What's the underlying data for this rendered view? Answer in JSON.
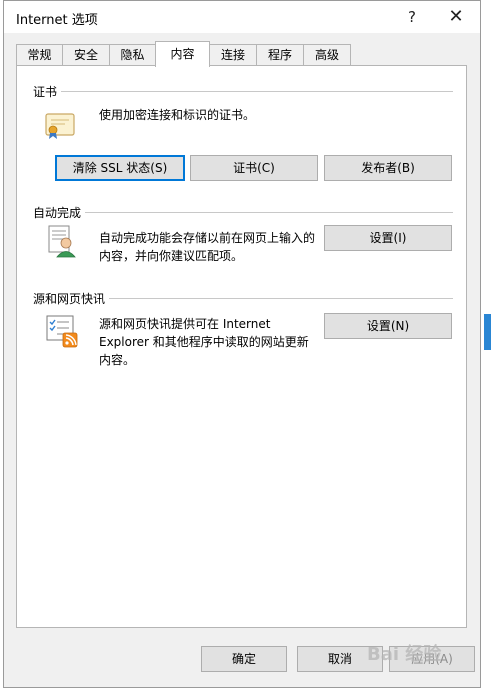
{
  "window": {
    "title": "Internet 选项",
    "help_label": "?",
    "close_label": "✕"
  },
  "tabs": [
    {
      "label": "常规"
    },
    {
      "label": "安全"
    },
    {
      "label": "隐私"
    },
    {
      "label": "内容",
      "active": true
    },
    {
      "label": "连接"
    },
    {
      "label": "程序"
    },
    {
      "label": "高级"
    }
  ],
  "certificates": {
    "group_title": "证书",
    "description": "使用加密连接和标识的证书。",
    "icon": "certificate-icon",
    "buttons": {
      "clear_ssl": "清除 SSL 状态(S)",
      "certificates": "证书(C)",
      "publishers": "发布者(B)"
    }
  },
  "autocomplete": {
    "group_title": "自动完成",
    "description_line1": "自动完成功能会存储以前在网页上输入的",
    "description_line2": "内容，并向你建议匹配项。",
    "icon": "autocomplete-user-icon",
    "settings_button": "设置(I)"
  },
  "feeds": {
    "group_title": "源和网页快讯",
    "description_line1": "源和网页快讯提供可在 Internet",
    "description_line2": "Explorer 和其他程序中读取的网站更新",
    "description_line3": "内容。",
    "icon": "rss-feed-icon",
    "settings_button": "设置(N)"
  },
  "footer": {
    "ok": "确定",
    "cancel": "取消",
    "apply": "应用(A)"
  },
  "watermark": {
    "text": "Bai 经验"
  },
  "colors": {
    "accent": "#0078d7",
    "dialog_bg": "#f0f0f0",
    "button_bg": "#e1e1e1"
  }
}
